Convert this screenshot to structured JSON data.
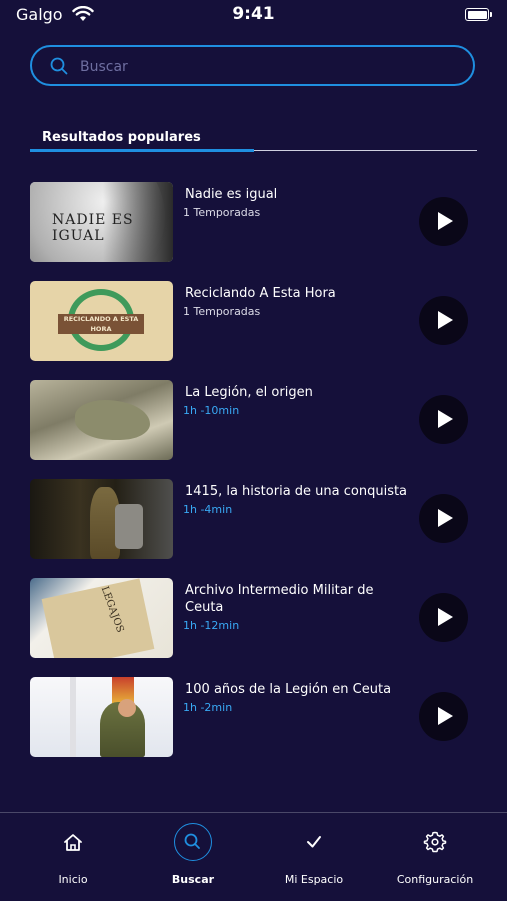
{
  "status_bar": {
    "carrier": "Galgo",
    "time": "9:41"
  },
  "search": {
    "placeholder": "Buscar",
    "value": ""
  },
  "section": {
    "tab_label": "Resultados populares"
  },
  "results": [
    {
      "title": "Nadie es igual",
      "meta": "1 Temporadas",
      "thumb_text": "NADIE ES IGUAL"
    },
    {
      "title": "Reciclando A Esta Hora",
      "meta": "1 Temporadas",
      "thumb_text": "RECICLANDO A ESTA HORA"
    },
    {
      "title": "La Legión, el origen",
      "meta": "1h -10min"
    },
    {
      "title": "1415, la historia de una conquista",
      "meta": "1h -4min"
    },
    {
      "title": "Archivo Intermedio Militar de Ceuta",
      "meta": "1h -12min",
      "thumb_text": "LEGAJOS"
    },
    {
      "title": "100 años de la Legión en Ceuta",
      "meta": "1h -2min"
    }
  ],
  "tab_bar": {
    "items": [
      {
        "label": "Inicio",
        "icon": "home-icon"
      },
      {
        "label": "Buscar",
        "icon": "search-icon",
        "active": true
      },
      {
        "label": "Mi Espacio",
        "icon": "check-icon"
      },
      {
        "label": "Configuración",
        "icon": "gear-icon"
      }
    ]
  },
  "colors": {
    "background": "#15103a",
    "accent": "#1f8fe0",
    "duration": "#39a9f4"
  }
}
